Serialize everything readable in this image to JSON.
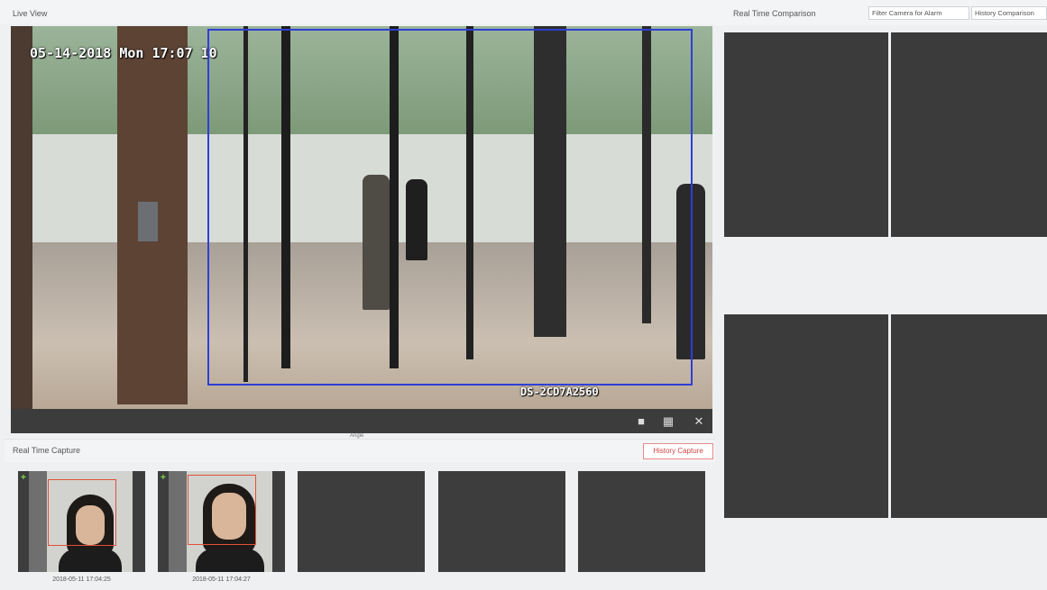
{
  "live_view": {
    "title": "Live View",
    "osd_datetime": "05-14-2018 Mon 17:07 10",
    "osd_camera_id": "DS-2CD7A2560",
    "toolbar": {
      "center_label": "Angle",
      "icons": [
        "stop-icon",
        "layout-icon",
        "close-icon"
      ]
    }
  },
  "real_time_capture": {
    "title": "Real Time Capture",
    "history_button": "History Capture",
    "captures": [
      {
        "time": "2018-05-11 17:04:25"
      },
      {
        "time": "2018-05-11 17:04:27"
      }
    ],
    "empty_slots": 3
  },
  "real_time_comparison": {
    "title": "Real Time Comparison",
    "buttons": {
      "filter": "Filter Camera for Alarm",
      "history": "History Comparison"
    },
    "tiles": 4
  },
  "colors": {
    "roi_box": "#2f3fd6",
    "face_box": "#e0503a",
    "add_marker": "#7ddc4b",
    "history_capture_text": "#d24646",
    "tile_bg": "#3b3b3b"
  }
}
